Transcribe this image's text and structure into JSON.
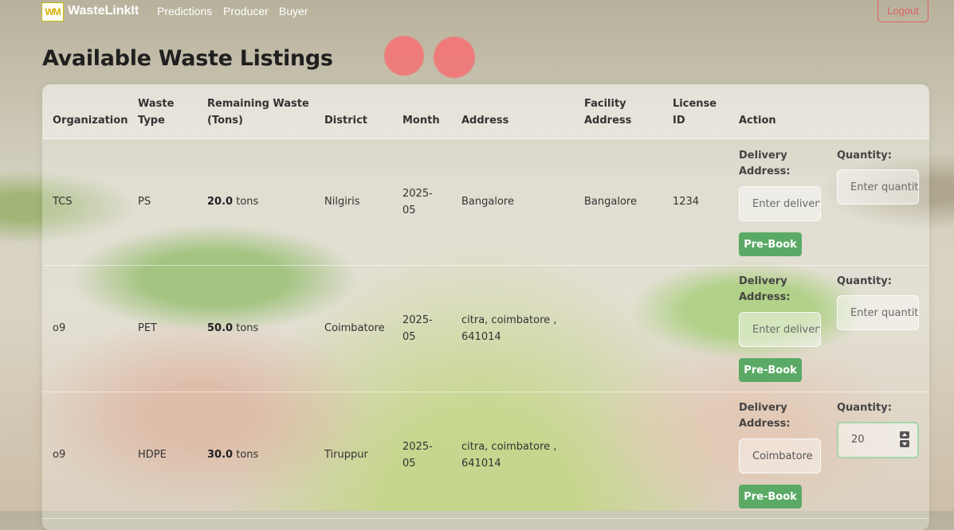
{
  "navbar": {
    "logo_text": "WM",
    "brand": "WasteLinkIt",
    "links": [
      "Predictions",
      "Producer",
      "Buyer"
    ],
    "logout": "Logout"
  },
  "page_title": "Available Waste Listings",
  "table": {
    "headers": {
      "organization": "Organization",
      "waste_type": [
        "Waste",
        "Type"
      ],
      "remaining": [
        "Remaining Waste",
        "(Tons)"
      ],
      "district": "District",
      "month": "Month",
      "address": "Address",
      "facility": [
        "Facility",
        "Address"
      ],
      "license": [
        "License",
        "ID"
      ],
      "action": "Action"
    },
    "unit": "tons",
    "action_labels": {
      "delivery": [
        "Delivery",
        "Address:"
      ],
      "quantity": "Quantity:",
      "delivery_placeholder": "Enter delivery address",
      "quantity_placeholder": "Enter quantity",
      "button": "Pre-Book"
    },
    "rows": [
      {
        "organization": "TCS",
        "waste_type": "PS",
        "remaining": "20.0",
        "district": "Nilgiris",
        "month": [
          "2025-",
          "05"
        ],
        "address": [
          "Bangalore",
          ""
        ],
        "facility": "Bangalore",
        "license": "1234",
        "delivery_value": "",
        "quantity_value": ""
      },
      {
        "organization": "o9",
        "waste_type": "PET",
        "remaining": "50.0",
        "district": "Coimbatore",
        "month": [
          "2025-",
          "05"
        ],
        "address": [
          "citra, coimbatore ,",
          "641014"
        ],
        "facility": "",
        "license": "",
        "delivery_value": "",
        "quantity_value": ""
      },
      {
        "organization": "o9",
        "waste_type": "HDPE",
        "remaining": "30.0",
        "district": "Tiruppur",
        "month": [
          "2025-",
          "05"
        ],
        "address": [
          "citra, coimbatore ,",
          "641014"
        ],
        "facility": "",
        "license": "",
        "delivery_value": "Coimbatore",
        "quantity_value": "20"
      }
    ]
  }
}
